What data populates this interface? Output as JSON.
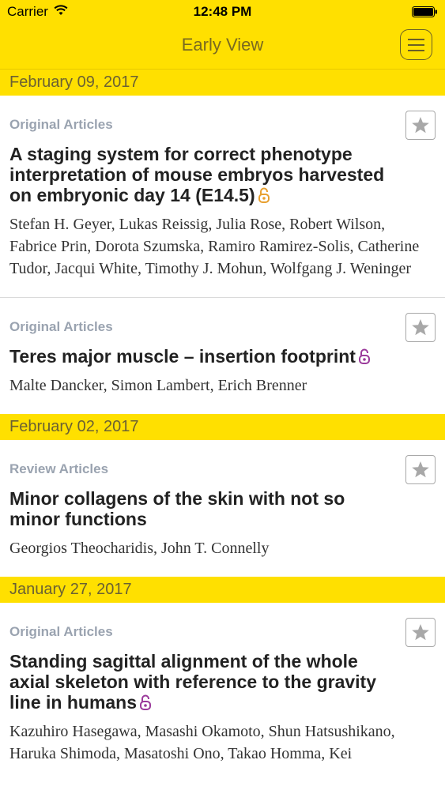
{
  "status_bar": {
    "carrier": "Carrier",
    "time": "12:48 PM"
  },
  "nav": {
    "title": "Early View"
  },
  "colors": {
    "accent_yellow": "#FFE000",
    "category_gray": "#9AA3B0",
    "open_access_orange": "#E8A030",
    "open_access_purple": "#9B3A9B"
  },
  "groups": [
    {
      "date": "February 09, 2017",
      "articles": [
        {
          "category": "Original Articles",
          "title": "A staging system for correct phenotype interpretation of mouse embryos harvested on embryonic day 14 (E14.5)",
          "open_access_icon": "open-lock-orange",
          "authors": "Stefan H. Geyer, Lukas Reissig, Julia Rose, Robert Wilson, Fabrice Prin, Dorota Szumska, Ramiro Ramirez-Solis, Catherine Tudor, Jacqui White, Timothy J. Mohun, Wolfgang J. Weninger"
        },
        {
          "category": "Original Articles",
          "title": "Teres major muscle – insertion footprint",
          "open_access_icon": "open-lock-purple",
          "authors": "Malte Dancker, Simon Lambert, Erich Brenner"
        }
      ]
    },
    {
      "date": "February 02, 2017",
      "articles": [
        {
          "category": "Review Articles",
          "title": "Minor collagens of the skin with not so minor functions",
          "open_access_icon": "",
          "authors": "Georgios Theocharidis, John T. Connelly"
        }
      ]
    },
    {
      "date": "January 27, 2017",
      "articles": [
        {
          "category": "Original Articles",
          "title": "Standing sagittal alignment of the whole axial skeleton with reference to the gravity line in humans",
          "open_access_icon": "open-lock-purple",
          "authors": "Kazuhiro Hasegawa, Masashi Okamoto, Shun Hatsushikano, Haruka Shimoda, Masatoshi Ono, Takao Homma, Kei"
        }
      ]
    }
  ]
}
